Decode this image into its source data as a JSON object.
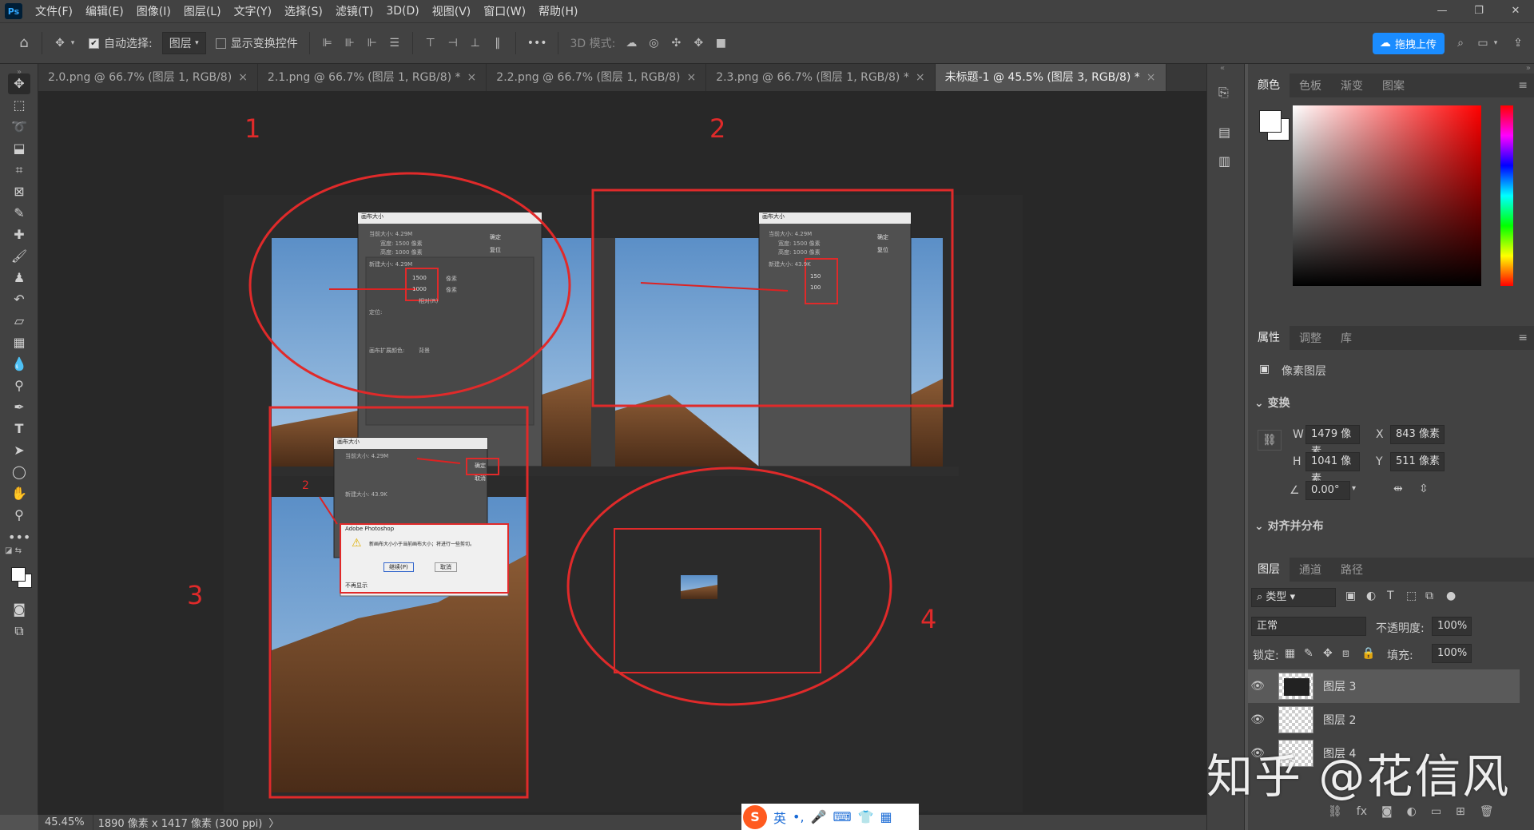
{
  "app": {
    "logo": "Ps"
  },
  "menu": [
    "文件(F)",
    "编辑(E)",
    "图像(I)",
    "图层(L)",
    "文字(Y)",
    "选择(S)",
    "滤镜(T)",
    "3D(D)",
    "视图(V)",
    "窗口(W)",
    "帮助(H)"
  ],
  "window_controls": {
    "minimize": "—",
    "restore": "❐",
    "close": "✕"
  },
  "options": {
    "auto_select_label": "自动选择:",
    "auto_select_value": "图层",
    "show_transform_label": "显示变换控件",
    "mode_3d_label": "3D 模式:",
    "more": "•••",
    "upload_label": "拖拽上传"
  },
  "tabs": [
    {
      "label": "2.0.png @ 66.7% (图层 1, RGB/8)",
      "close": "×"
    },
    {
      "label": "2.1.png @ 66.7% (图层 1, RGB/8) *",
      "close": "×"
    },
    {
      "label": "2.2.png @ 66.7% (图层 1, RGB/8)",
      "close": "×"
    },
    {
      "label": "2.3.png @ 66.7% (图层 1, RGB/8) *",
      "close": "×"
    },
    {
      "label": "未标题-1 @ 45.5% (图层 3, RGB/8) *",
      "close": "×",
      "active": true
    }
  ],
  "canvas_annotations": {
    "n1": "1",
    "n2": "2",
    "n3": "3",
    "n4": "4",
    "n2_small": "2",
    "dialog_title": "画布大小",
    "current_size": "当前大小: 4.29M",
    "width_1500": "宽度: 1500 像素",
    "height_1000": "高度: 1000 像素",
    "new_size_1": "新建大小: 4.29M",
    "new_size_2": "新建大小: 43.9K",
    "ok": "确定",
    "reset": "复位",
    "cancel": "取消",
    "val_1500": "1500",
    "val_1000": "1000",
    "val_150": "150",
    "val_100": "100",
    "unit": "像素",
    "anchor": "定位:",
    "relative": "相对(R)",
    "ext_color": "画布扩展颜色:",
    "bg": "背景",
    "alert_title": "Adobe Photoshop",
    "alert_text": "新画布大小小于当前画布大小；将进行一些剪切。",
    "continue": "继续(P)",
    "dont_show": "不再显示"
  },
  "status": {
    "zoom": "45.45%",
    "doc_size": "1890 像素 x 1417 像素 (300 ppi)",
    "arrow": "〉"
  },
  "color_panel": {
    "tabs": [
      "颜色",
      "色板",
      "渐变",
      "图案"
    ]
  },
  "props_panel": {
    "tabs": [
      "属性",
      "调整",
      "库"
    ],
    "layer_type": "像素图层",
    "transform_title": "变换",
    "w_label": "W",
    "w_value": "1479 像素",
    "x_label": "X",
    "x_value": "843 像素",
    "h_label": "H",
    "h_value": "1041 像素",
    "y_label": "Y",
    "y_value": "511 像素",
    "angle_value": "0.00°",
    "align_title": "对齐并分布"
  },
  "layers_panel": {
    "tabs": [
      "图层",
      "通道",
      "路径"
    ],
    "filter_label": "类型",
    "blend_mode": "正常",
    "opacity_label": "不透明度:",
    "opacity_value": "100%",
    "lock_label": "锁定:",
    "fill_label": "填充:",
    "fill_value": "100%",
    "layers": [
      {
        "name": "图层 3"
      },
      {
        "name": "图层 2"
      },
      {
        "name": "图层 4"
      }
    ]
  },
  "watermark": "知乎 @花信风",
  "ime": {
    "logo": "S",
    "lang": "英",
    "punct": "•,"
  }
}
